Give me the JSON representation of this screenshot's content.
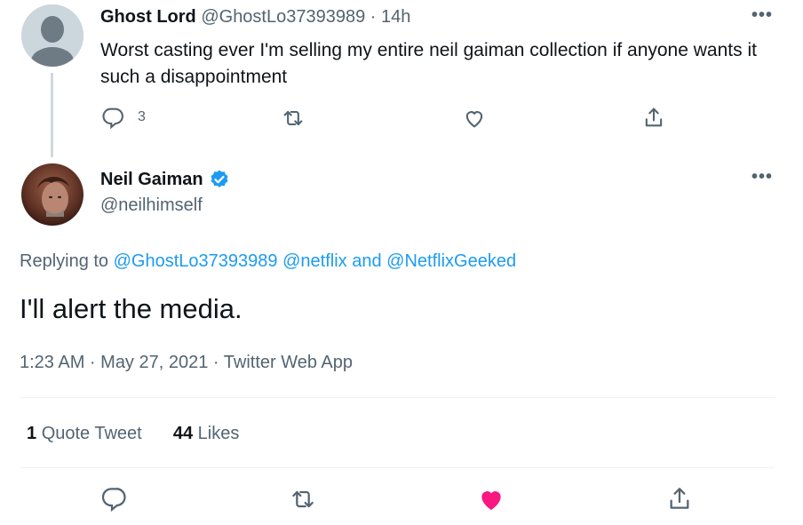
{
  "parent_tweet": {
    "display_name": "Ghost Lord",
    "handle": "@GhostLo37393989",
    "separator": "·",
    "time": "14h",
    "text": "Worst casting ever I'm selling my entire neil gaiman collection if anyone wants it such a disappointment",
    "reply_count": "3"
  },
  "main_tweet": {
    "display_name": "Neil Gaiman",
    "handle": "@neilhimself",
    "replying_prefix": "Replying to",
    "replying_to_1": "@GhostLo37393989",
    "replying_to_2": "@netflix",
    "replying_and": "and",
    "replying_to_3": "@NetflixGeeked",
    "text": "I'll alert the media.",
    "timestamp": "1:23 AM · May 27, 2021 · Twitter Web App",
    "quote_count": "1",
    "quote_label": "Quote Tweet",
    "like_count": "44",
    "like_label": "Likes",
    "liked": true
  },
  "more_menu_glyph": "•••",
  "colors": {
    "accent_blue": "#1d9bf0",
    "muted_text": "#536471",
    "like_red": "#f91880"
  },
  "icons": [
    "more-icon",
    "reply-icon",
    "retweet-icon",
    "like-icon",
    "share-icon",
    "verified-badge-icon"
  ]
}
